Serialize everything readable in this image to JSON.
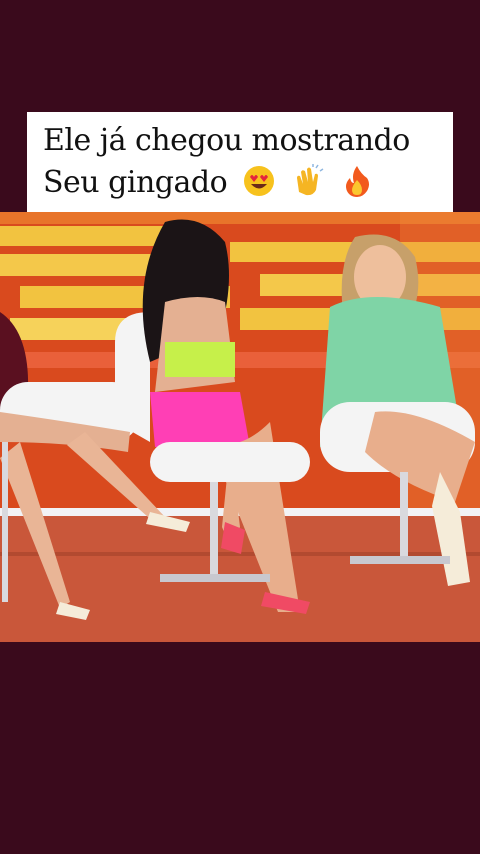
{
  "caption": {
    "line1": "Ele já chegou mostrando",
    "line2": "Seu gingado",
    "emojis": [
      "heart-eyes-emoji",
      "clapping-hands-emoji",
      "fire-emoji"
    ]
  },
  "video": {
    "description_icon": "tv-studio-scene"
  },
  "colors": {
    "background": "#3a0a1c",
    "caption_bg": "#ffffff",
    "studio_red": "#d94a1e",
    "studio_yellow": "#f2c340",
    "floor": "#c9573a"
  }
}
